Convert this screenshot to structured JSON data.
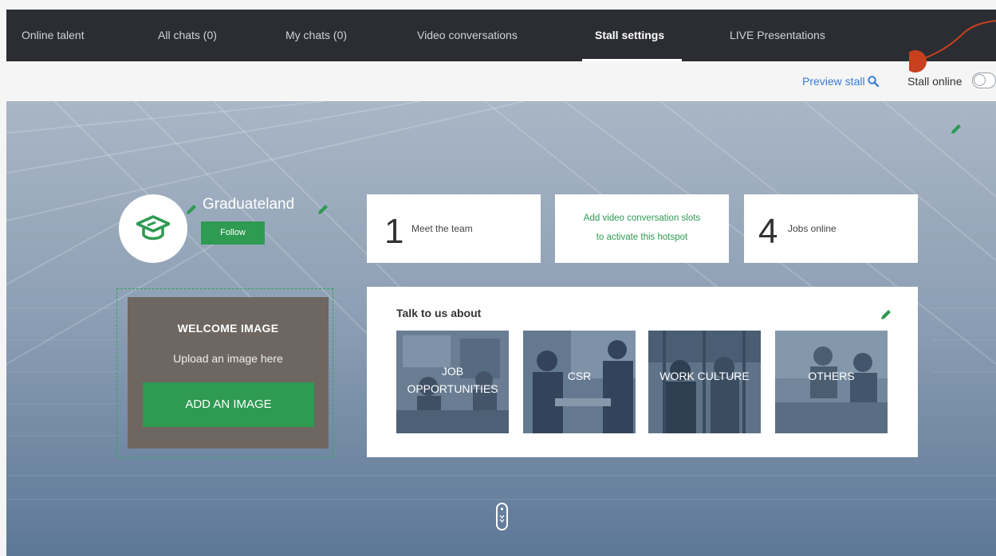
{
  "nav": {
    "tabs": [
      {
        "label": "Online talent"
      },
      {
        "label": "All chats (0)"
      },
      {
        "label": "My chats (0)"
      },
      {
        "label": "Video conversations"
      },
      {
        "label": "Stall settings"
      },
      {
        "label": "LIVE Presentations"
      }
    ],
    "active_tab": "Stall settings"
  },
  "toolbar": {
    "preview_label": "Preview stall",
    "stall_online_label": "Stall online",
    "stall_online": false
  },
  "company": {
    "name": "Graduateland",
    "follow_label": "Follow"
  },
  "cards": {
    "team": {
      "number": "1",
      "label": "Meet the team"
    },
    "video": {
      "line1": "Add video conversation slots",
      "line2": "to activate this hotspot"
    },
    "jobs": {
      "number": "4",
      "label": "Jobs online"
    }
  },
  "welcome": {
    "title": "WELCOME IMAGE",
    "subtitle": "Upload an image here",
    "button": "ADD AN IMAGE"
  },
  "talk": {
    "heading": "Talk to us about",
    "topics": [
      {
        "line1": "JOB",
        "line2": "OPPORTUNITIES"
      },
      {
        "line1": "CSR",
        "line2": ""
      },
      {
        "line1": "WORK CULTURE",
        "line2": ""
      },
      {
        "line1": "OTHERS",
        "line2": ""
      }
    ]
  },
  "colors": {
    "nav_bg": "#2b2d33",
    "accent_green": "#2e9a52",
    "link_blue": "#3a7bd5",
    "annotation_red": "#c8401e"
  },
  "icons": {
    "preview": "search-icon",
    "edit": "pencil-icon",
    "logo": "graduation-cap-icon",
    "scroll": "scroll-mouse-icon"
  }
}
